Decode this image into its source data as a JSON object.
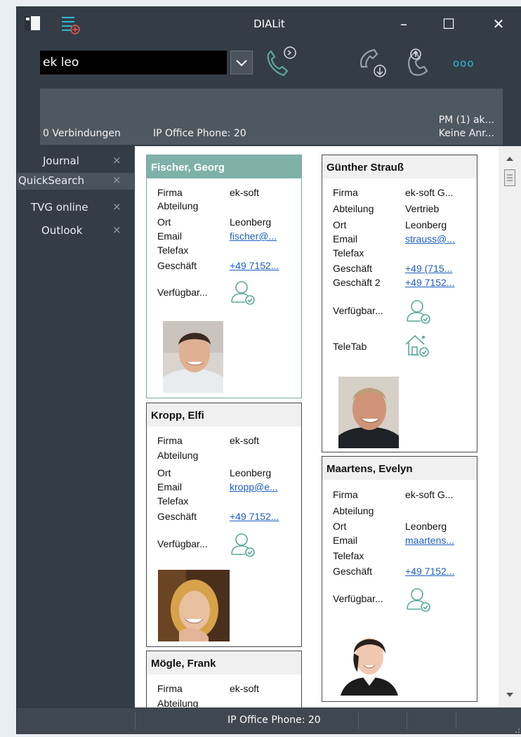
{
  "window": {
    "title": "DIALit",
    "controls": {
      "minimize": "–",
      "maximize": "☐",
      "close": "✕"
    }
  },
  "toolbar": {
    "search_value": "ek leo",
    "more_label": "ooo"
  },
  "info": {
    "connections": "0 Verbindungen",
    "phone": "IP Office Phone: 20",
    "pm": "PM (1) ak...",
    "calls": "Keine Anr..."
  },
  "tabs": [
    {
      "label": "Journal",
      "close": "×"
    },
    {
      "label": "QuickSearch",
      "close": "×"
    },
    {
      "label": "TVG online",
      "close": "×"
    },
    {
      "label": "Outlook",
      "close": "×"
    }
  ],
  "cards": {
    "fischer": {
      "name": "Fischer, Georg",
      "rows": [
        {
          "label": "Firma",
          "value": "ek-soft",
          "link": false
        },
        {
          "label": "Abteilung",
          "value": "",
          "link": false
        },
        {
          "label": "Ort",
          "value": "Leonberg",
          "link": false
        },
        {
          "label": "Email",
          "value": "fischer@...",
          "link": true
        },
        {
          "label": "Telefax",
          "value": "",
          "link": false
        },
        {
          "label": "Geschäft",
          "value": "+49 7152...",
          "link": true
        }
      ],
      "availability": "Verfügbar..."
    },
    "kropp": {
      "name": "Kropp, Elfi",
      "rows": [
        {
          "label": "Firma",
          "value": "ek-soft",
          "link": false
        },
        {
          "label": "Abteilung",
          "value": "",
          "link": false
        },
        {
          "label": "Ort",
          "value": "Leonberg",
          "link": false
        },
        {
          "label": "Email",
          "value": "kropp@e...",
          "link": true
        },
        {
          "label": "Telefax",
          "value": "",
          "link": false
        },
        {
          "label": "Geschäft",
          "value": "+49 7152...",
          "link": true
        }
      ],
      "availability": "Verfügbar..."
    },
    "moegle": {
      "name": "Mögle, Frank",
      "rows": [
        {
          "label": "Firma",
          "value": "ek-soft",
          "link": false
        },
        {
          "label": "Abteilung",
          "value": "",
          "link": false
        }
      ]
    },
    "strauss": {
      "name": "Günther Strauß",
      "rows": [
        {
          "label": "Firma",
          "value": "ek-soft G...",
          "link": false
        },
        {
          "label": "Abteilung",
          "value": "Vertrieb",
          "link": false
        },
        {
          "label": "Ort",
          "value": "Leonberg",
          "link": false
        },
        {
          "label": "Email",
          "value": "strauss@...",
          "link": true
        },
        {
          "label": "Telefax",
          "value": "",
          "link": false
        },
        {
          "label": "Geschäft",
          "value": "+49 (715...",
          "link": true
        },
        {
          "label": "Geschäft 2",
          "value": "+49 7152...",
          "link": true
        }
      ],
      "availability": "Verfügbar...",
      "teletab": "TeleTab"
    },
    "maartens": {
      "name": "Maartens, Evelyn",
      "rows": [
        {
          "label": "Firma",
          "value": "ek-soft G...",
          "link": false
        },
        {
          "label": "Abteilung",
          "value": "",
          "link": false
        },
        {
          "label": "Ort",
          "value": "Leonberg",
          "link": false
        },
        {
          "label": "Email",
          "value": "maartens...",
          "link": true
        },
        {
          "label": "Telefax",
          "value": "",
          "link": false
        },
        {
          "label": "Geschäft",
          "value": "+49 7152...",
          "link": true
        }
      ],
      "availability": "Verfügbar..."
    }
  },
  "statusbar": {
    "text": "IP Office Phone: 20"
  },
  "colors": {
    "accent": "#2dbad6",
    "icon_green": "#5aa89a",
    "selected_header": "#7fb1a9"
  }
}
